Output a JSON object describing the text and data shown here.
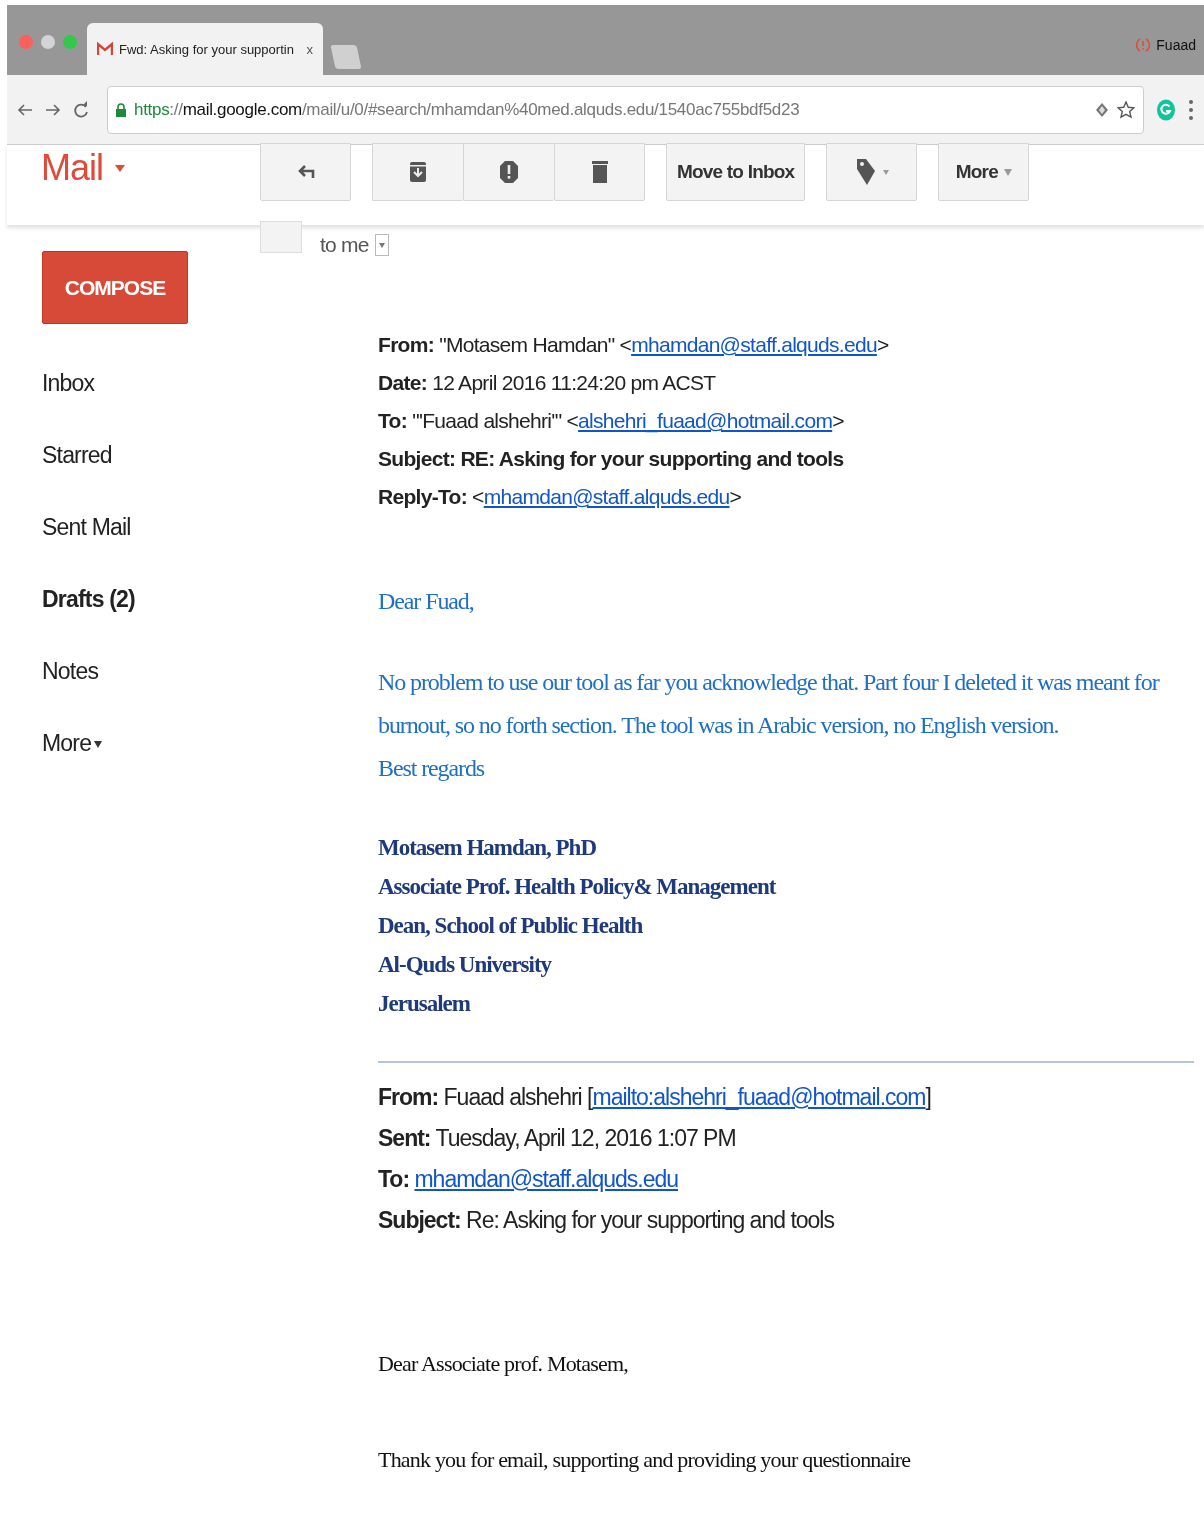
{
  "browser": {
    "tab_title": "Fwd: Asking for your supportin",
    "tab_close": "x",
    "url": {
      "scheme": "https",
      "separator": "://",
      "host": "mail.google.com",
      "path": "/mail/u/0/#search/mhamdan%40med.alquds.edu/1540ac755bdf5d23"
    },
    "profile": "Fuaad"
  },
  "gmail": {
    "logo": "Mail",
    "toolbar": [
      {
        "kind": "reply"
      },
      {
        "kind": "archive"
      },
      {
        "kind": "spam"
      },
      {
        "kind": "delete"
      },
      {
        "kind": "text",
        "label": "Move to Inbox"
      },
      {
        "kind": "labels"
      },
      {
        "kind": "menu",
        "label": "More"
      }
    ],
    "compose": "COMPOSE",
    "nav": [
      {
        "label": "Inbox",
        "bold": false,
        "kind": "item"
      },
      {
        "label": "Starred",
        "bold": false,
        "kind": "item"
      },
      {
        "label": "Sent Mail",
        "bold": false,
        "kind": "item"
      },
      {
        "label": "Drafts (2)",
        "bold": true,
        "kind": "item"
      },
      {
        "label": "Notes",
        "bold": false,
        "kind": "item"
      },
      {
        "label": "More",
        "bold": false,
        "kind": "menu"
      }
    ]
  },
  "message": {
    "recipient": "to me",
    "headers": [
      {
        "label": "From:",
        "value": "\"Motasem Hamdan\" <",
        "link": "mhamdan@staff.alquds.edu",
        "after": ">",
        "bold": false
      },
      {
        "label": "Date:",
        "value": "12 April 2016 11:24:20 pm ACST",
        "bold": false
      },
      {
        "label": "To:",
        "value": "\"'Fuaad alshehri'\" <",
        "link": "alshehri_fuaad@hotmail.com",
        "after": ">",
        "bold": false
      },
      {
        "label": "Subject:",
        "value": "RE: Asking for your supporting and tools",
        "bold": true
      },
      {
        "label": "Reply-To:",
        "value": "<",
        "link": "mhamdan@staff.alquds.edu",
        "after": ">",
        "bold": false
      }
    ],
    "greeting": "Dear Fuad,",
    "paragraph": "No problem to use our tool as far you acknowledge that. Part four I deleted it was meant for burnout, so no forth section. The tool was in Arabic version, no English version.",
    "closing": "Best regards",
    "signature": [
      "Motasem Hamdan, PhD",
      "Associate Prof. Health Policy& Management",
      "Dean, School of Public Health",
      "Al-Quds University",
      "Jerusalem"
    ],
    "quoted_headers": [
      {
        "label": "From:",
        "value": "Fuaad alshehri [",
        "link": "mailto:alshehri_fuaad@hotmail.com",
        "after": "]"
      },
      {
        "label": "Sent:",
        "value": "Tuesday, April 12, 2016 1:07 PM"
      },
      {
        "label": "To:",
        "link": "mhamdan@staff.alquds.edu"
      },
      {
        "label": "Subject:",
        "value": "Re: Asking for your supporting and tools"
      }
    ],
    "quoted_greeting": "Dear Associate prof. Motasem,",
    "quoted_line": "Thank you for email, supporting and providing your questionnaire"
  }
}
